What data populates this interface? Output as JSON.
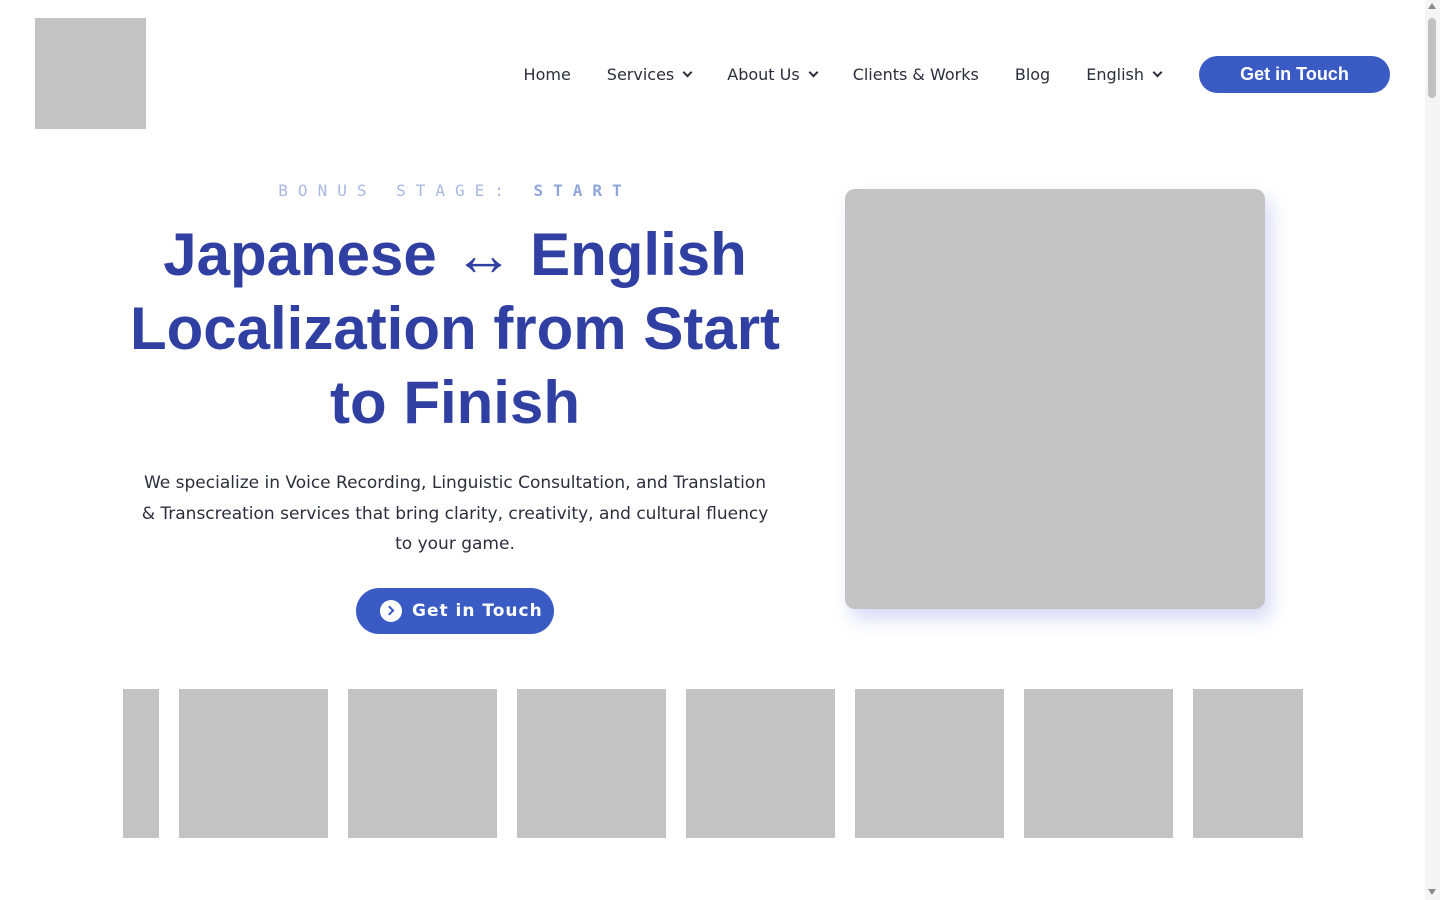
{
  "header": {
    "logo_icon": "site-logo-placeholder",
    "nav": [
      {
        "label": "Home",
        "has_dropdown": false
      },
      {
        "label": "Services",
        "has_dropdown": true
      },
      {
        "label": "About Us",
        "has_dropdown": true
      },
      {
        "label": "Clients & Works",
        "has_dropdown": false
      },
      {
        "label": "Blog",
        "has_dropdown": false
      },
      {
        "label": "English",
        "has_dropdown": true
      }
    ],
    "cta_label": "Get in Touch"
  },
  "hero": {
    "eyebrow_prefix": "BONUS STAGE:",
    "eyebrow_highlight": "START",
    "headline_line1": "Japanese ↔ English",
    "headline_line2": "Localization from Start",
    "headline_line3": "to Finish",
    "subtext": "We specialize in Voice Recording, Linguistic Consultation, and Translation & Transcreation services that bring clarity, creativity, and cultural fluency to your game.",
    "cta_label": "Get in Touch",
    "cta_icon": "chevron-right-circle-icon"
  },
  "client_logos": {
    "count_visible": 8
  },
  "colors": {
    "primary": "#3a5bc4",
    "headline": "#2f3fa2",
    "eyebrow": "#a9b9e2",
    "placeholder": "#c3c3c3"
  }
}
